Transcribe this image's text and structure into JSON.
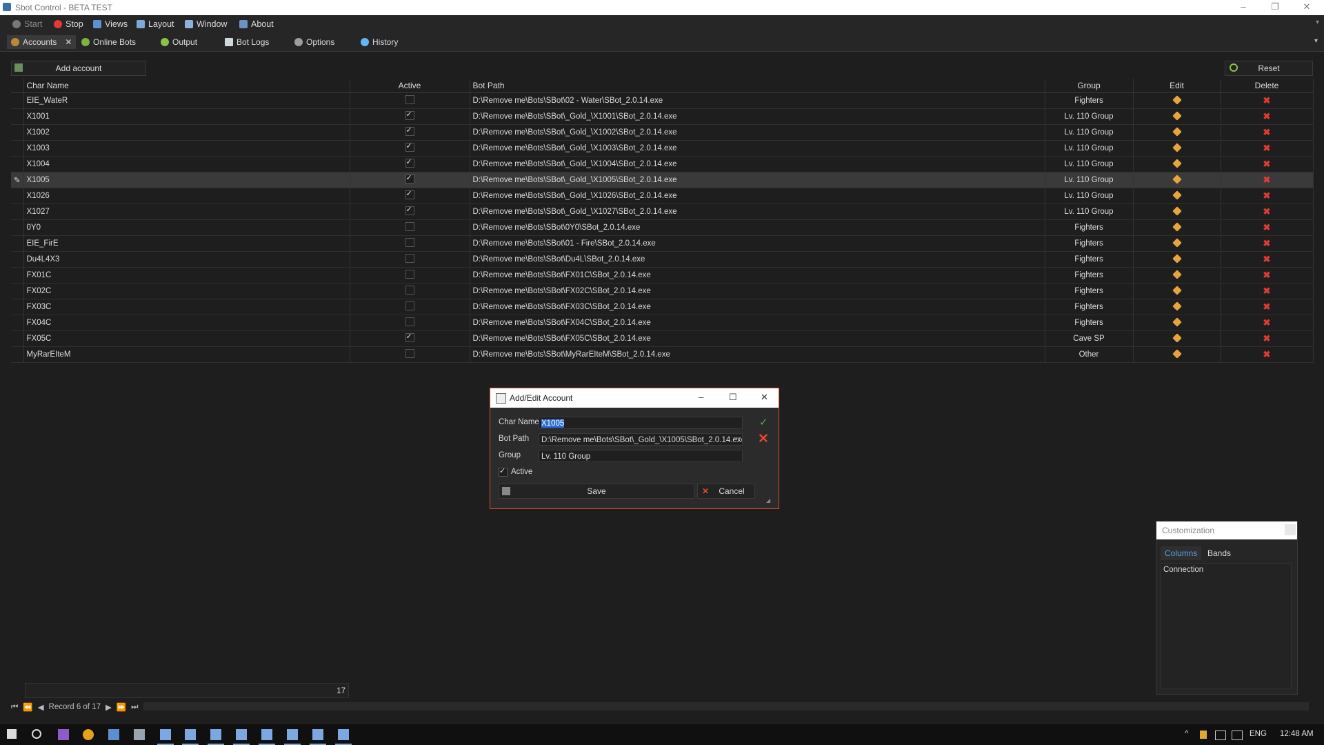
{
  "window": {
    "title": "Sbot Control - BETA TEST"
  },
  "menu": [
    {
      "label": "Start",
      "icon": "start-icon"
    },
    {
      "label": "Stop",
      "icon": "stop-icon"
    },
    {
      "label": "Views",
      "icon": "views-icon"
    },
    {
      "label": "Layout",
      "icon": "layout-icon"
    },
    {
      "label": "Window",
      "icon": "window-icon"
    },
    {
      "label": "About",
      "icon": "about-icon"
    }
  ],
  "tabs": [
    {
      "label": "Accounts",
      "active": true
    },
    {
      "label": "Online Bots"
    },
    {
      "label": "Output"
    },
    {
      "label": "Bot Logs"
    },
    {
      "label": "Options"
    },
    {
      "label": "History"
    }
  ],
  "toolbar": {
    "add_account": "Add account",
    "reset": "Reset"
  },
  "grid": {
    "columns": [
      "Char Name",
      "Active",
      "Bot Path",
      "Group",
      "Edit",
      "Delete"
    ],
    "rows": [
      {
        "name": "EIE_WateR",
        "active": false,
        "path": "D:\\Remove me\\Bots\\SBot\\02 - Water\\SBot_2.0.14.exe",
        "group": "Fighters"
      },
      {
        "name": "X1001",
        "active": true,
        "path": "D:\\Remove me\\Bots\\SBot\\_Gold_\\X1001\\SBot_2.0.14.exe",
        "group": "Lv. 110 Group"
      },
      {
        "name": "X1002",
        "active": true,
        "path": "D:\\Remove me\\Bots\\SBot\\_Gold_\\X1002\\SBot_2.0.14.exe",
        "group": "Lv. 110 Group"
      },
      {
        "name": "X1003",
        "active": true,
        "path": "D:\\Remove me\\Bots\\SBot\\_Gold_\\X1003\\SBot_2.0.14.exe",
        "group": "Lv. 110 Group"
      },
      {
        "name": "X1004",
        "active": true,
        "path": "D:\\Remove me\\Bots\\SBot\\_Gold_\\X1004\\SBot_2.0.14.exe",
        "group": "Lv. 110 Group"
      },
      {
        "name": "X1005",
        "active": true,
        "path": "D:\\Remove me\\Bots\\SBot\\_Gold_\\X1005\\SBot_2.0.14.exe",
        "group": "Lv. 110 Group",
        "selected": true
      },
      {
        "name": "X1026",
        "active": true,
        "path": "D:\\Remove me\\Bots\\SBot\\_Gold_\\X1026\\SBot_2.0.14.exe",
        "group": "Lv. 110 Group"
      },
      {
        "name": "X1027",
        "active": true,
        "path": "D:\\Remove me\\Bots\\SBot\\_Gold_\\X1027\\SBot_2.0.14.exe",
        "group": "Lv. 110 Group"
      },
      {
        "name": "0Y0",
        "active": false,
        "path": "D:\\Remove me\\Bots\\SBot\\0Y0\\SBot_2.0.14.exe",
        "group": "Fighters"
      },
      {
        "name": "EIE_FirE",
        "active": false,
        "path": "D:\\Remove me\\Bots\\SBot\\01 - Fire\\SBot_2.0.14.exe",
        "group": "Fighters"
      },
      {
        "name": "Du4L4X3",
        "active": false,
        "path": "D:\\Remove me\\Bots\\SBot\\Du4L\\SBot_2.0.14.exe",
        "group": "Fighters"
      },
      {
        "name": "FX01C",
        "active": false,
        "path": "D:\\Remove me\\Bots\\SBot\\FX01C\\SBot_2.0.14.exe",
        "group": "Fighters"
      },
      {
        "name": "FX02C",
        "active": false,
        "path": "D:\\Remove me\\Bots\\SBot\\FX02C\\SBot_2.0.14.exe",
        "group": "Fighters"
      },
      {
        "name": "FX03C",
        "active": false,
        "path": "D:\\Remove me\\Bots\\SBot\\FX03C\\SBot_2.0.14.exe",
        "group": "Fighters"
      },
      {
        "name": "FX04C",
        "active": false,
        "path": "D:\\Remove me\\Bots\\SBot\\FX04C\\SBot_2.0.14.exe",
        "group": "Fighters"
      },
      {
        "name": "FX05C",
        "active": true,
        "path": "D:\\Remove me\\Bots\\SBot\\FX05C\\SBot_2.0.14.exe",
        "group": "Cave SP"
      },
      {
        "name": "MyRarEIteM",
        "active": false,
        "path": "D:\\Remove me\\Bots\\SBot\\MyRarEIteM\\SBot_2.0.14.exe",
        "group": "Other"
      }
    ]
  },
  "dialog": {
    "title": "Add/Edit Account",
    "char_name_label": "Char Name",
    "char_name": "X1005",
    "bot_path_label": "Bot Path",
    "bot_path": "D:\\Remove me\\Bots\\SBot\\_Gold_\\X1005\\SBot_2.0.14.exe",
    "browse": "···",
    "group_label": "Group",
    "group": "Lv. 110 Group",
    "active_label": "Active",
    "active": true,
    "save": "Save",
    "cancel": "Cancel"
  },
  "customization": {
    "title": "Customization",
    "tabs": [
      "Columns",
      "Bands"
    ],
    "items": [
      "Connection"
    ]
  },
  "footer": {
    "total": "17",
    "record": "Record 6 of 17"
  },
  "taskbar": {
    "lang": "ENG",
    "time": "12:48 AM"
  },
  "colors": {
    "accent": "#2f6fd6",
    "delete": "#e53935",
    "dialog_border": "#d9502f"
  }
}
